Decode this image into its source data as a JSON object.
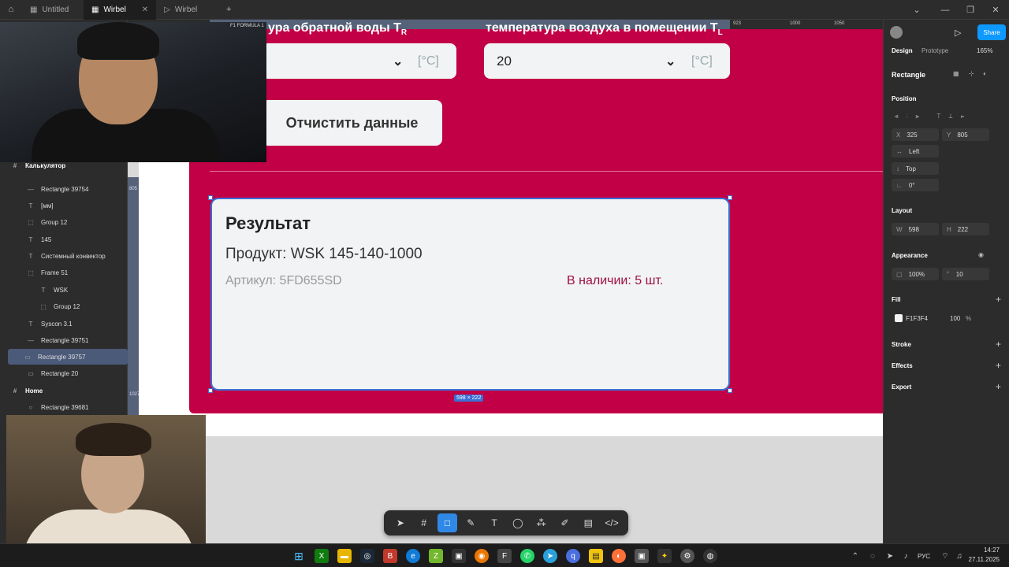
{
  "tabs": [
    {
      "label": "Untitled"
    },
    {
      "label": "Wirbel"
    },
    {
      "label": "Wirbel"
    }
  ],
  "layers": [
    {
      "label": "Калькулятор",
      "type": "frame"
    },
    {
      "label": "Rectangle 39754",
      "type": "line"
    },
    {
      "label": "[мм]",
      "type": "text"
    },
    {
      "label": "Group 12",
      "type": "group"
    },
    {
      "label": "145",
      "type": "text"
    },
    {
      "label": "Системный конвектор",
      "type": "text"
    },
    {
      "label": "Frame 51",
      "type": "frame-inner"
    },
    {
      "label": "WSK",
      "type": "text"
    },
    {
      "label": "Group 12",
      "type": "group"
    },
    {
      "label": "Syscon 3.1",
      "type": "text"
    },
    {
      "label": "Rectangle 39751",
      "type": "line"
    },
    {
      "label": "Rectangle 39757",
      "type": "rect"
    },
    {
      "label": "Rectangle 20",
      "type": "rect"
    },
    {
      "label": "Home",
      "type": "frame"
    },
    {
      "label": "Rectangle 39681",
      "type": "circle"
    }
  ],
  "rulers": {
    "h": [
      "923",
      "1000",
      "1050"
    ],
    "v": [
      "805",
      "1027"
    ]
  },
  "design": {
    "field1": {
      "label": "ура обратной воды T",
      "sub": "R",
      "unit": "[°C]"
    },
    "field2": {
      "label": "температура воздуха в помещении T",
      "sub": "L",
      "value": "20",
      "unit": "[°C]"
    },
    "clear_button": "Отчистить данные",
    "result": {
      "title": "Результат",
      "product": "Продукт: WSK 145-140-1000",
      "article": "Артикул: 5FD655SD",
      "stock": "В наличии: 5 шт."
    },
    "size_badge": "598 × 222"
  },
  "right": {
    "share": "Share",
    "tab_design": "Design",
    "tab_prototype": "Prototype",
    "zoom": "165%",
    "layer_type": "Rectangle",
    "position": "Position",
    "x_label": "X",
    "x": "325",
    "y_label": "Y",
    "y": "805",
    "constraint_h": "Left",
    "constraint_v": "Top",
    "rotation": "0°",
    "layout": "Layout",
    "w_label": "W",
    "w": "598",
    "h_label": "H",
    "h": "222",
    "appearance": "Appearance",
    "opacity": "100%",
    "radius": "10",
    "fill": "Fill",
    "fill_hex": "F1F3F4",
    "fill_opacity": "100",
    "fill_pct": "%",
    "stroke": "Stroke",
    "effects": "Effects",
    "export": "Export"
  },
  "webcam_logo": "F1 FORMULA 1",
  "taskbar": {
    "lang": "РУС",
    "time": "14:27",
    "date": "27.11.2025"
  },
  "colors": {
    "brand_red": "#c20045",
    "fill": "#F1F3F4",
    "selection": "#3b6fd4",
    "share": "#0d99ff"
  }
}
